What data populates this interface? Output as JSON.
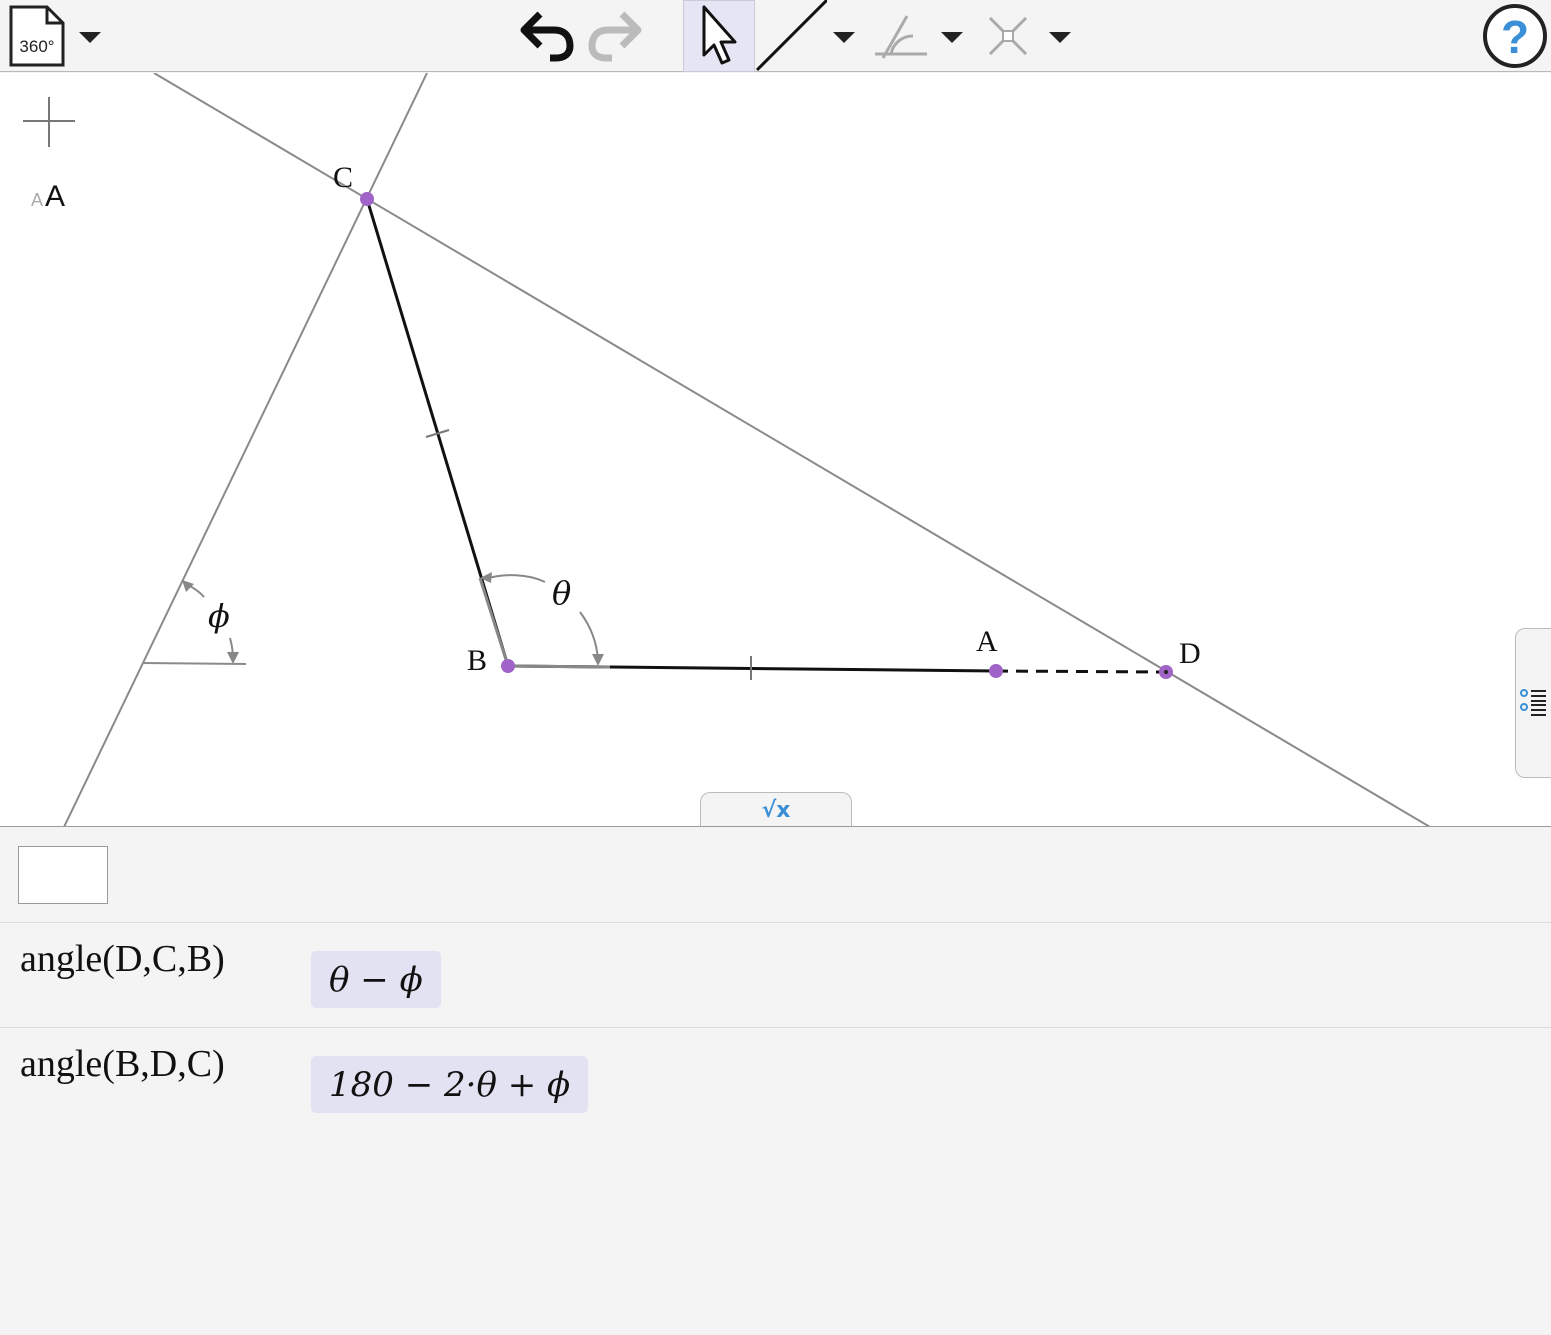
{
  "toolbar": {
    "document_badge": "360°",
    "help_symbol": "?"
  },
  "canvas": {
    "font_size_small": "A",
    "font_size_large": "A",
    "points": {
      "A": "A",
      "B": "B",
      "C": "C",
      "D": "D"
    },
    "angle_labels": {
      "theta": "θ",
      "phi": "ϕ"
    }
  },
  "math_tab": {
    "label": "√x"
  },
  "panel": {
    "input_value": "",
    "rows": [
      {
        "expression": "angle(D,C,B)",
        "result": "θ − ϕ"
      },
      {
        "expression": "angle(B,D,C)",
        "result": "180 − 2·θ + ϕ"
      }
    ]
  },
  "colors": {
    "point": "#a064c8",
    "result_bg": "#e2e2f2",
    "help_blue": "#3a8fd6"
  }
}
